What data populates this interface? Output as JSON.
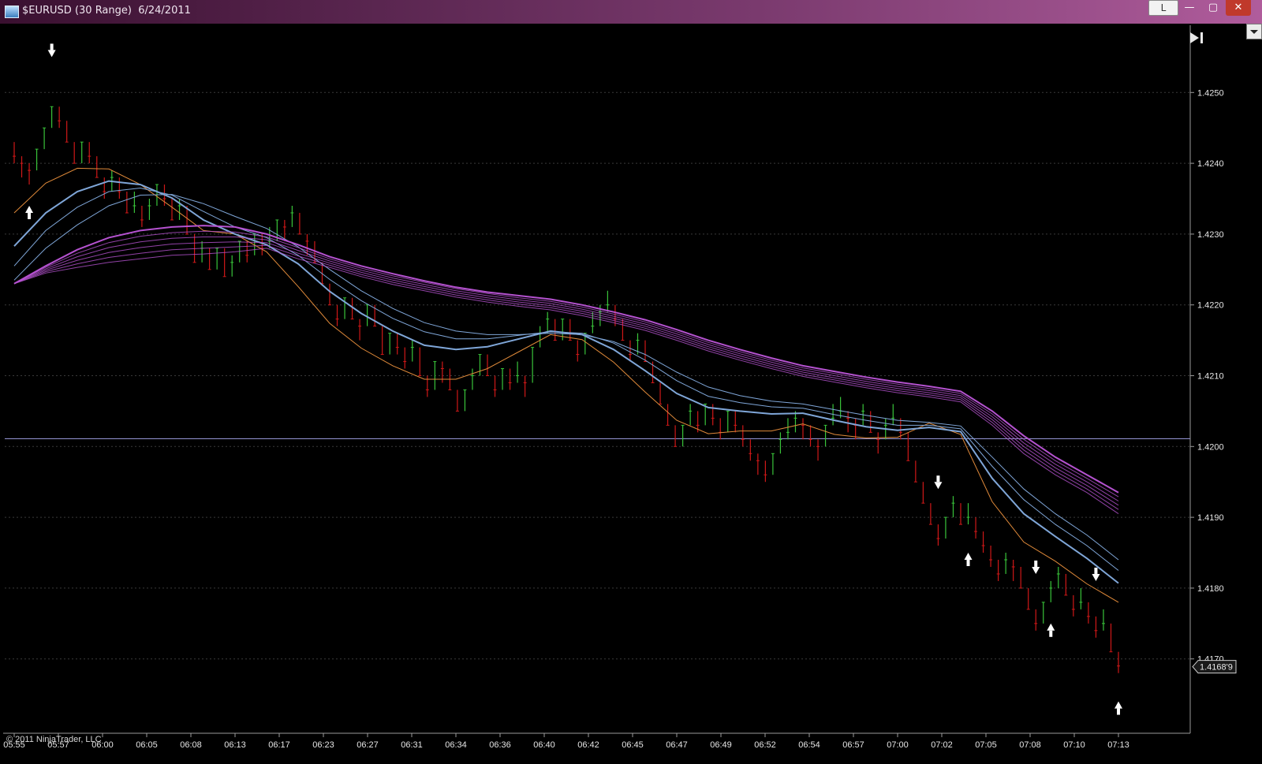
{
  "window": {
    "title": "$EURUSD (30 Range)  6/24/2011",
    "btn_l": "L",
    "btn_min": "—",
    "btn_max": "▢",
    "btn_close": "✕"
  },
  "copyright": "© 2011 NinjaTrader, LLC",
  "icons": [
    "chart-app-icon",
    "scroll-to-end-icon",
    "chevron-down-icon",
    "buy-arrow-icon",
    "sell-arrow-icon"
  ],
  "colors": {
    "background": "#000000",
    "up_bar": "#39c43a",
    "down_bar": "#d01818",
    "grid": "#3a3a3a",
    "horizontal_line": "#8c8cc8",
    "fast_ema": "#e08a3a",
    "mid_ema": "#7fa6d8",
    "slow_ema": "#b552d0",
    "axis_text": "#e6e6e6"
  },
  "chart_data": {
    "type": "line",
    "instrument": "$EURUSD",
    "bar_type": "30 Range",
    "date": "6/24/2011",
    "ylim": [
      1.41595,
      1.42595
    ],
    "y_ticks": [
      "1.4250",
      "1.4240",
      "1.4230",
      "1.4220",
      "1.4210",
      "1.4200",
      "1.4190",
      "1.4180",
      "1.4170"
    ],
    "x_tick_labels": [
      "05:55",
      "05:57",
      "06:00",
      "06:05",
      "06:08",
      "06:13",
      "06:17",
      "06:23",
      "06:27",
      "06:31",
      "06:34",
      "06:36",
      "06:40",
      "06:42",
      "06:45",
      "06:47",
      "06:49",
      "06:52",
      "06:54",
      "06:57",
      "07:00",
      "07:02",
      "07:05",
      "07:08",
      "07:10",
      "07:13"
    ],
    "last_price_label": "1.4168'9",
    "last_price": 1.41689,
    "horizontal_line_price": 1.42011,
    "bars_close": [
      1.4241,
      1.424,
      1.4239,
      1.4242,
      1.4245,
      1.4248,
      1.4246,
      1.4243,
      1.424,
      1.4243,
      1.4241,
      1.4238,
      1.4236,
      1.4238,
      1.4236,
      1.4233,
      1.4234,
      1.4232,
      1.4234,
      1.4237,
      1.4235,
      1.4232,
      1.4234,
      1.423,
      1.4226,
      1.4228,
      1.4225,
      1.4228,
      1.4224,
      1.4226,
      1.4229,
      1.4227,
      1.423,
      1.4228,
      1.4229,
      1.4232,
      1.4231,
      1.4233,
      1.423,
      1.4229,
      1.4226,
      1.4223,
      1.422,
      1.4218,
      1.4221,
      1.4218,
      1.4217,
      1.422,
      1.4217,
      1.4213,
      1.4216,
      1.4214,
      1.4212,
      1.4214,
      1.421,
      1.4208,
      1.4212,
      1.4211,
      1.4208,
      1.4205,
      1.4208,
      1.421,
      1.4213,
      1.421,
      1.4208,
      1.4211,
      1.4209,
      1.421,
      1.4209,
      1.4214,
      1.4216,
      1.4218,
      1.4215,
      1.4218,
      1.4215,
      1.4213,
      1.4216,
      1.4217,
      1.4219,
      1.422,
      1.4218,
      1.4215,
      1.4213,
      1.4215,
      1.4212,
      1.4209,
      1.4206,
      1.4203,
      1.42,
      1.4203,
      1.4205,
      1.4203,
      1.4206,
      1.4204,
      1.4202,
      1.4205,
      1.4203,
      1.4201,
      1.4199,
      1.4198,
      1.4196,
      1.4199,
      1.4201,
      1.4202,
      1.4204,
      1.4203,
      1.4201,
      1.42,
      1.4203,
      1.4204,
      1.4205,
      1.4204,
      1.4203,
      1.4205,
      1.4202,
      1.4201,
      1.4203,
      1.4204,
      1.4202,
      1.4198,
      1.4195,
      1.4192,
      1.4189,
      1.4187,
      1.419,
      1.4192,
      1.4189,
      1.419,
      1.4188,
      1.4186,
      1.4184,
      1.4182,
      1.4184,
      1.4183,
      1.418,
      1.4177,
      1.4175,
      1.4178,
      1.418,
      1.4182,
      1.4179,
      1.4177,
      1.4178,
      1.4176,
      1.4174,
      1.4175,
      1.4171,
      1.4169
    ],
    "series": [
      {
        "name": "",
        "values": [
          1.4233,
          1.42372,
          1.42393,
          1.42392,
          1.4237,
          1.42338,
          1.42305,
          1.423,
          1.42275,
          1.42226,
          1.42174,
          1.42139,
          1.42114,
          1.42095,
          1.42095,
          1.4211,
          1.42134,
          1.42158,
          1.42151,
          1.42119,
          1.42077,
          1.42037,
          1.42018,
          1.42022,
          1.42022,
          1.42032,
          1.42017,
          1.42012,
          1.42013,
          1.42033,
          1.42017,
          1.41922,
          1.41865,
          1.41838,
          1.41806,
          1.4178
        ]
      },
      {
        "name": "",
        "values": [
          1.42283,
          1.4233,
          1.4236,
          1.42375,
          1.4237,
          1.42351,
          1.4232,
          1.423,
          1.42285,
          1.42258,
          1.42219,
          1.42188,
          1.42163,
          1.42143,
          1.42137,
          1.42141,
          1.42152,
          1.42163,
          1.42158,
          1.42137,
          1.42107,
          1.42075,
          1.42055,
          1.4205,
          1.42046,
          1.42047,
          1.42037,
          1.42028,
          1.42023,
          1.42027,
          1.42021,
          1.41955,
          1.41905,
          1.41873,
          1.41842,
          1.41807
        ]
      },
      {
        "name": "",
        "values": [
          1.42255,
          1.42305,
          1.42338,
          1.4236,
          1.42365,
          1.42355,
          1.42332,
          1.4231,
          1.42295,
          1.4227,
          1.42236,
          1.42206,
          1.42181,
          1.42162,
          1.42152,
          1.42152,
          1.42157,
          1.42162,
          1.4216,
          1.42146,
          1.42122,
          1.42093,
          1.42071,
          1.42062,
          1.42056,
          1.42054,
          1.42045,
          1.42037,
          1.4203,
          1.4203,
          1.42025,
          1.41972,
          1.41925,
          1.4189,
          1.4186,
          1.41825
        ]
      },
      {
        "name": "",
        "values": [
          1.42235,
          1.4228,
          1.42313,
          1.4234,
          1.42355,
          1.42356,
          1.42343,
          1.42325,
          1.42308,
          1.42282,
          1.4225,
          1.4222,
          1.42195,
          1.42175,
          1.42163,
          1.42158,
          1.42158,
          1.4216,
          1.42158,
          1.42148,
          1.4213,
          1.42105,
          1.42084,
          1.42072,
          1.42064,
          1.4206,
          1.42052,
          1.42044,
          1.42037,
          1.42034,
          1.42029,
          1.41985,
          1.4194,
          1.41905,
          1.41875,
          1.4184
        ]
      },
      {
        "name": "",
        "values": [
          1.4223,
          1.42255,
          1.42278,
          1.42295,
          1.42305,
          1.4231,
          1.42312,
          1.4231,
          1.423,
          1.42285,
          1.42268,
          1.42255,
          1.42244,
          1.42234,
          1.42225,
          1.42218,
          1.42213,
          1.42208,
          1.422,
          1.4219,
          1.42179,
          1.42165,
          1.4215,
          1.42137,
          1.42125,
          1.42114,
          1.42106,
          1.42098,
          1.42091,
          1.42085,
          1.42078,
          1.4205,
          1.42015,
          1.41985,
          1.4196,
          1.41935
        ]
      },
      {
        "name": "",
        "values": [
          1.4223,
          1.42253,
          1.42273,
          1.42288,
          1.42297,
          1.42302,
          1.42304,
          1.42303,
          1.42296,
          1.42281,
          1.42265,
          1.42252,
          1.42241,
          1.42232,
          1.42223,
          1.42216,
          1.4221,
          1.42205,
          1.42197,
          1.42187,
          1.42176,
          1.42162,
          1.42147,
          1.42134,
          1.42122,
          1.42111,
          1.42103,
          1.42095,
          1.42088,
          1.42082,
          1.42075,
          1.42046,
          1.4201,
          1.4198,
          1.41955,
          1.41929
        ]
      },
      {
        "name": "",
        "values": [
          1.4223,
          1.42251,
          1.42268,
          1.42281,
          1.42289,
          1.42294,
          1.42296,
          1.42296,
          1.42292,
          1.42277,
          1.42262,
          1.42249,
          1.42238,
          1.42229,
          1.4222,
          1.42213,
          1.42207,
          1.42202,
          1.42194,
          1.42184,
          1.42173,
          1.42159,
          1.42144,
          1.42131,
          1.42119,
          1.42108,
          1.421,
          1.42092,
          1.42085,
          1.42079,
          1.42072,
          1.42042,
          1.42005,
          1.41975,
          1.4195,
          1.41923
        ]
      },
      {
        "name": "",
        "values": [
          1.4223,
          1.42249,
          1.42263,
          1.42274,
          1.42281,
          1.42286,
          1.42288,
          1.42289,
          1.42288,
          1.42273,
          1.42259,
          1.42246,
          1.42235,
          1.42226,
          1.42217,
          1.4221,
          1.42204,
          1.42199,
          1.42191,
          1.42181,
          1.4217,
          1.42156,
          1.42141,
          1.42128,
          1.42116,
          1.42105,
          1.42097,
          1.42089,
          1.42082,
          1.42076,
          1.42069,
          1.42038,
          1.42,
          1.4197,
          1.41945,
          1.41917
        ]
      },
      {
        "name": "",
        "values": [
          1.4223,
          1.42247,
          1.42258,
          1.42267,
          1.42273,
          1.42278,
          1.4228,
          1.42282,
          1.42284,
          1.42269,
          1.42256,
          1.42243,
          1.42232,
          1.42223,
          1.42214,
          1.42207,
          1.42201,
          1.42196,
          1.42188,
          1.42178,
          1.42167,
          1.42153,
          1.42138,
          1.42125,
          1.42113,
          1.42102,
          1.42094,
          1.42086,
          1.42079,
          1.42073,
          1.42066,
          1.42034,
          1.41995,
          1.41965,
          1.4194,
          1.41911
        ]
      },
      {
        "name": "",
        "values": [
          1.4223,
          1.42245,
          1.42253,
          1.4226,
          1.42265,
          1.4227,
          1.42272,
          1.42275,
          1.4228,
          1.42265,
          1.42253,
          1.4224,
          1.42229,
          1.4222,
          1.42211,
          1.42204,
          1.42198,
          1.42193,
          1.42185,
          1.42175,
          1.42164,
          1.4215,
          1.42135,
          1.42122,
          1.4211,
          1.42099,
          1.42091,
          1.42083,
          1.42076,
          1.4207,
          1.42063,
          1.4203,
          1.4199,
          1.4196,
          1.41935,
          1.41905
        ]
      }
    ],
    "signals": [
      {
        "bar": 2,
        "dir": "up",
        "label": ""
      },
      {
        "bar": 5,
        "dir": "down",
        "label": ""
      },
      {
        "bar": 123,
        "dir": "down",
        "label": ""
      },
      {
        "bar": 127,
        "dir": "up",
        "label": ""
      },
      {
        "bar": 138,
        "dir": "up",
        "label": ""
      },
      {
        "bar": 136,
        "dir": "down",
        "label": ""
      },
      {
        "bar": 144,
        "dir": "down",
        "label": ""
      },
      {
        "bar": 147,
        "dir": "up",
        "label": ""
      }
    ]
  }
}
